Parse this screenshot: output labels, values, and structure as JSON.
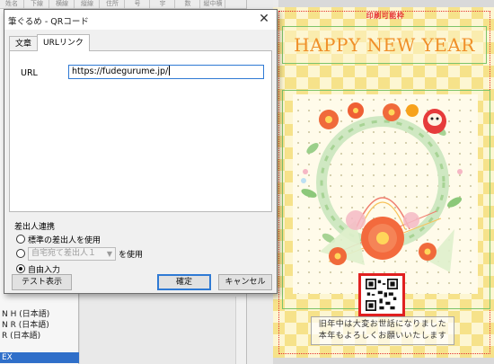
{
  "background": {
    "toolbar_items": [
      "姓名",
      "下線",
      "横線",
      "縦線",
      "住所",
      "号",
      "宇",
      "数",
      "縦中横"
    ],
    "fonts_list": [
      "N H (日本語)",
      "N R (日本語)",
      "R (日本語)",
      "",
      "EX"
    ],
    "card": {
      "print_area_label": "印刷可能枠",
      "title": "HAPPY NEW YEAR",
      "message_line1": "旧年中は大変お世話になりました",
      "message_line2": "本年もよろしくお願いいたします"
    }
  },
  "dialog": {
    "title": "筆ぐるめ - QRコード",
    "close_glyph": "✕",
    "tabs": [
      "文章",
      "URLリンク"
    ],
    "active_tab": "URLリンク",
    "url_label": "URL",
    "url_value": "https://fudegurume.jp/",
    "sender_group_title": "差出人連携",
    "options": {
      "standard": "標準の差出人を使用",
      "address_select": "自宅宛て差出人１",
      "use_suffix": "を使用",
      "free_input": "自由入力"
    },
    "selected_option": "free_input",
    "buttons": {
      "test": "テスト表示",
      "ok": "確定",
      "cancel": "キャンセル"
    }
  },
  "colors": {
    "title_orange": "#f0902a",
    "print_frame_red": "#e53030",
    "accent_blue": "#2f7ad4",
    "frame_green": "#7cc46b"
  }
}
